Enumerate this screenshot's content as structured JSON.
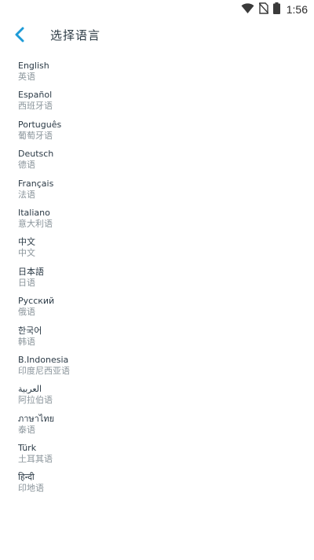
{
  "status_bar": {
    "time": "1:56",
    "icons": [
      "wifi-icon",
      "no-sim-icon",
      "battery-icon"
    ]
  },
  "header": {
    "back_icon": "chevron-left-icon",
    "title": "选择语言"
  },
  "colors": {
    "accent": "#1e9bd7",
    "title_text": "#2d3b45",
    "subtitle_text": "#8a949b"
  },
  "languages": [
    {
      "native": "English",
      "local": "英语"
    },
    {
      "native": "Español",
      "local": "西班牙语"
    },
    {
      "native": "Português",
      "local": "葡萄牙语"
    },
    {
      "native": "Deutsch",
      "local": "德语"
    },
    {
      "native": "Français",
      "local": "法语"
    },
    {
      "native": "Italiano",
      "local": "意大利语"
    },
    {
      "native": "中文",
      "local": "中文"
    },
    {
      "native": "日本語",
      "local": "日语"
    },
    {
      "native": "Русский",
      "local": "俄语"
    },
    {
      "native": "한국어",
      "local": "韩语"
    },
    {
      "native": "B.Indonesia",
      "local": "印度尼西亚语"
    },
    {
      "native": "العربية",
      "local": "阿拉伯语"
    },
    {
      "native": "ภาษาไทย",
      "local": "泰语"
    },
    {
      "native": "Türk",
      "local": "土耳其语"
    },
    {
      "native": "हिन्दी",
      "local": "印地语"
    }
  ]
}
